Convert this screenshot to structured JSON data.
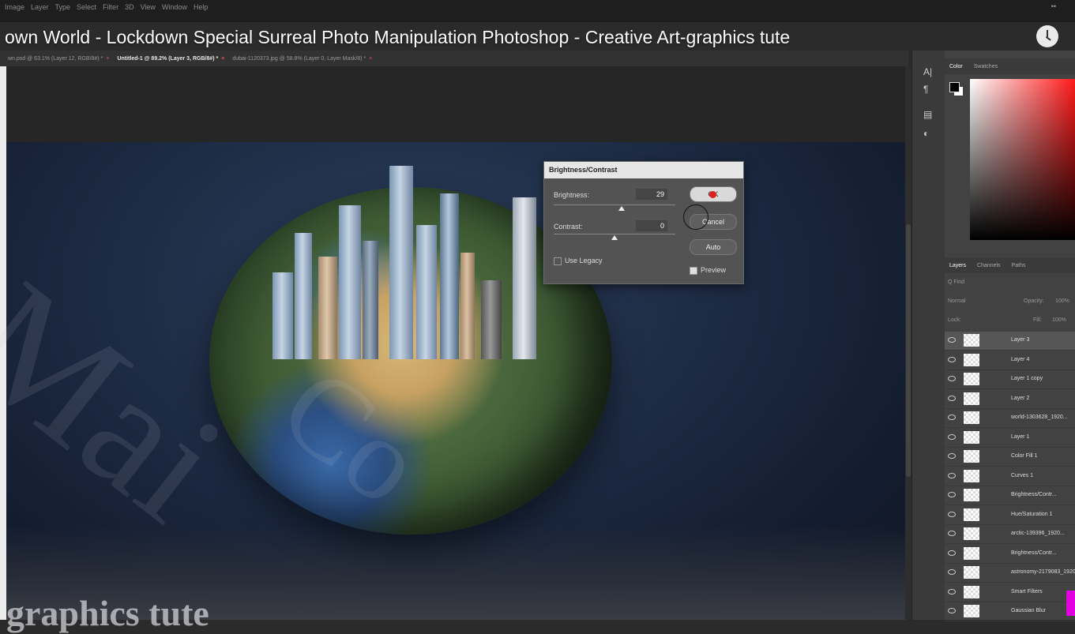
{
  "menubar": {
    "items": [
      "Image",
      "Layer",
      "Type",
      "Select",
      "Filter",
      "3D",
      "View",
      "Window",
      "Help"
    ],
    "dots": "••"
  },
  "video": {
    "title": "own World - Lockdown Special Surreal Photo Manipulation Photoshop - Creative Art-graphics tute",
    "clock_icon": "clock-icon"
  },
  "document_tabs": [
    {
      "label": "wn.psd @ 63.1% (Layer 12, RGB/8#) *",
      "active": false
    },
    {
      "label": "Untitled-1 @ 89.2% (Layer 3, RGB/8#) *",
      "active": true
    },
    {
      "label": "dubai-1120373.jpg @ 58.8% (Layer 0, Layer Mask/8) *",
      "active": false
    }
  ],
  "tab_close": "×",
  "watermark": {
    "diagonal": "Mai",
    "diagonal2": "Co",
    "bottom": "graphics tute"
  },
  "dialog": {
    "title": "Brightness/Contrast",
    "brightness_label": "Brightness:",
    "brightness_value": "29",
    "brightness_level": 0.56,
    "contrast_label": "Contrast:",
    "contrast_value": "0",
    "contrast_level": 0.5,
    "ok_label": "OK",
    "cancel_label": "Cancel",
    "auto_label": "Auto",
    "legacy_label": "Use Legacy",
    "legacy_checked": false,
    "preview_label": "Preview",
    "preview_checked": true
  },
  "toolstrip": [
    "A|",
    "¶",
    "▤",
    "◐"
  ],
  "color_panel": {
    "tabs": [
      "Color",
      "Swatches"
    ],
    "foreground": "#000000",
    "background": "#ffffff",
    "hue": "#ff1a1a"
  },
  "layers_panel": {
    "tabs": [
      "Layers",
      "Channels",
      "Paths"
    ],
    "search_placeholder": "Q Find",
    "blend_mode": "Normal",
    "opacity_label": "Opacity:",
    "opacity_value": "100%",
    "lock_label": "Lock:",
    "fill_label": "Fill:",
    "fill_value": "100%",
    "layers": [
      {
        "name": "Layer 3",
        "selected": true
      },
      {
        "name": "Layer 4",
        "selected": false
      },
      {
        "name": "Layer 1 copy",
        "selected": false
      },
      {
        "name": "Layer 2",
        "selected": false
      },
      {
        "name": "world-1303628_1920...",
        "selected": false
      },
      {
        "name": "Layer 1",
        "selected": false
      },
      {
        "name": "Color Fill 1",
        "selected": false
      },
      {
        "name": "Curves 1",
        "selected": false
      },
      {
        "name": "Brightness/Contr...",
        "selected": false
      },
      {
        "name": "Hue/Saturation 1",
        "selected": false
      },
      {
        "name": "arctic-139396_1920...",
        "selected": false
      },
      {
        "name": "Brightness/Contr...",
        "selected": false
      },
      {
        "name": "astronomy-2179083_1920...",
        "selected": false
      },
      {
        "name": "Smart Filters",
        "selected": false
      },
      {
        "name": "Gaussian Blur",
        "selected": false
      }
    ]
  },
  "accent": "#e02020"
}
